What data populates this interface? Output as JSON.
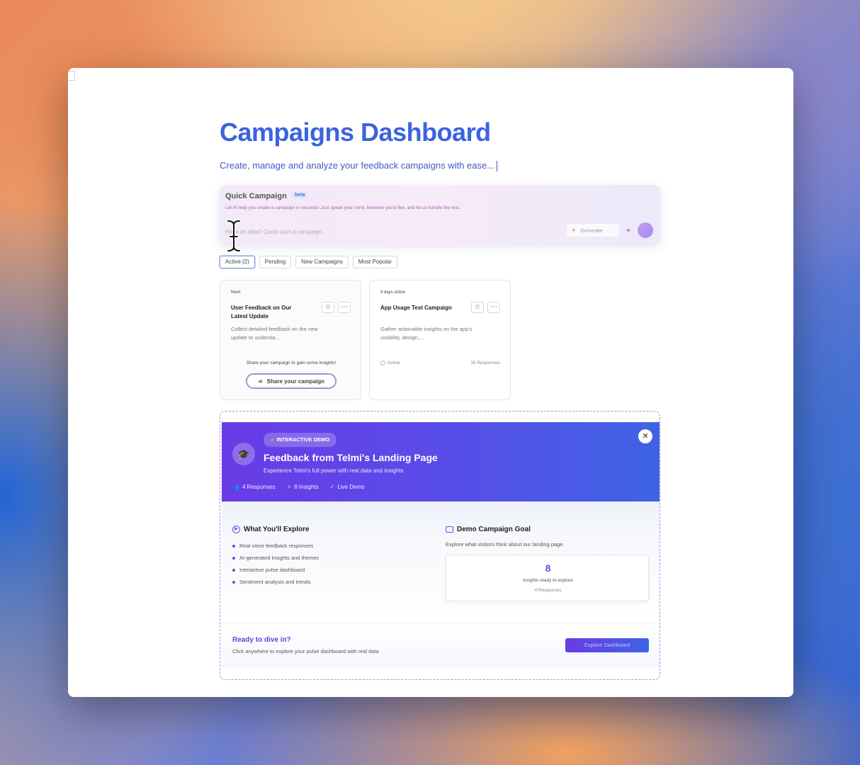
{
  "page": {
    "title": "Campaigns Dashboard",
    "subtitle": "Create, manage and analyze your feedback campaigns with ease..."
  },
  "quick_campaign": {
    "title": "Quick Campaign",
    "badge": "beta",
    "description": "Let AI help you create a campaign in seconds! Just speak your mind, however you'd like, and let us handle the rest.",
    "placeholder": "Have an idea? Quick-start a campaign...",
    "generate_label": "Generate",
    "add_symbol": "+"
  },
  "tabs": [
    {
      "label": "Active (2)",
      "active": true
    },
    {
      "label": "Pending",
      "active": false
    },
    {
      "label": "New Campaigns",
      "active": false
    },
    {
      "label": "Most Popular",
      "active": false
    }
  ],
  "cards": [
    {
      "badge": "New!",
      "title": "User Feedback on Our Latest Update",
      "description": "Collect detailed feedback on the new update to understa...",
      "share_hint": "Share your campaign to gain some insights!",
      "share_label": "Share your campaign"
    },
    {
      "badge": "8 days active",
      "title": "App Usage Test Campaign",
      "description": "Gather actionable insights on the app's usability, design,...",
      "status": "Active",
      "responses": "15 Responses"
    }
  ],
  "demo": {
    "pill": "INTERACTIVE DEMO",
    "title": "Feedback from Telmi's Landing Page",
    "subtitle": "Experience Telmi's full power with real data and insights",
    "stats": [
      "4 Responses",
      "8 Insights",
      "Live Demo"
    ],
    "explore_title": "What You'll Explore",
    "explore_items": [
      "Real voice feedback responses",
      "AI-generated insights and themes",
      "Interactive pulse dashboard",
      "Sentiment analysis and trends"
    ],
    "goal_title": "Demo Campaign Goal",
    "goal_desc": "Explore what visitors think about our landing page.",
    "goal_number": "8",
    "goal_label": "insights ready to explore",
    "goal_responses": "4 Responses",
    "ready_title": "Ready to dive in?",
    "ready_sub": "Click anywhere to explore your pulse dashboard with real data",
    "explore_button": "Explore Dashboard"
  },
  "colors": {
    "title": "#3b63e0",
    "accent_purple": "#6a3be6",
    "accent_blue": "#3f63e4"
  }
}
